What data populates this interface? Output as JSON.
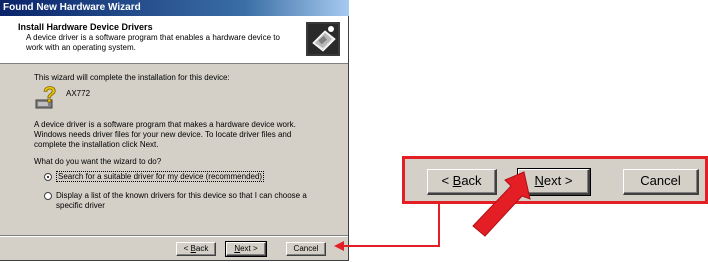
{
  "window": {
    "title": "Found New Hardware Wizard",
    "header_title": "Install Hardware Device Drivers",
    "header_description": "A device driver is a software program that enables a hardware device to work with an operating system."
  },
  "content": {
    "intro": "This wizard will complete the installation for this device:",
    "device_name": "AX772",
    "paragraph": "A device driver is a software program that makes a hardware device work. Windows needs driver files for your new device. To locate driver files and complete the installation click Next.",
    "question": "What do you want the wizard to do?",
    "options": [
      {
        "label": "Search for a suitable driver for my device (recommended)",
        "selected": true
      },
      {
        "label": "Display a list of the known drivers for this device so that I can choose a specific driver",
        "selected": false
      }
    ]
  },
  "buttons": {
    "back": {
      "hotkey": "B",
      "prefix": "< ",
      "rest": "ack"
    },
    "next": {
      "hotkey": "N",
      "rest": "ext >"
    },
    "cancel": "Cancel"
  },
  "zoom_buttons": {
    "back": {
      "hotkey": "B",
      "prefix": "< ",
      "rest": "ack"
    },
    "next": {
      "hotkey": "N",
      "rest": "ext >"
    },
    "cancel": "Cancel"
  },
  "icons": {
    "header": "hardware-install-icon",
    "device": "question-mark-device-icon",
    "pointer": "red-arrow-icon"
  },
  "colors": {
    "highlight": "#e41e25",
    "titlebar": "#0a246a",
    "dialog_face": "#d4d0c8"
  }
}
